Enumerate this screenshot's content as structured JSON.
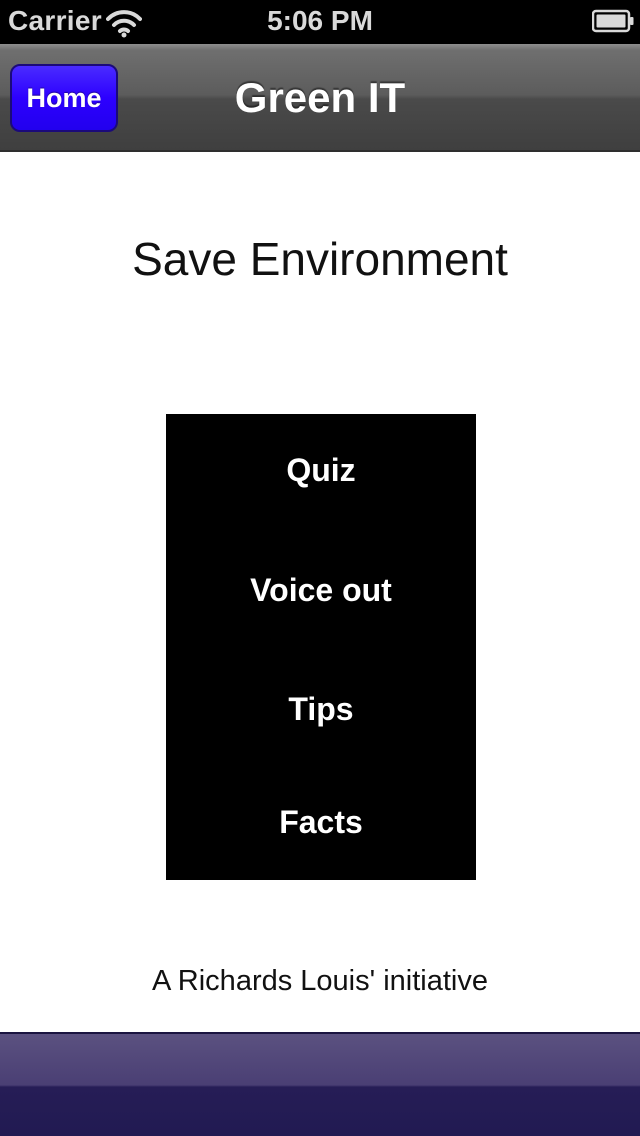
{
  "status_bar": {
    "carrier": "Carrier",
    "time": "5:06 PM",
    "wifi_icon": "wifi-icon",
    "battery_icon": "battery-icon"
  },
  "nav_bar": {
    "home_label": "Home",
    "title": "Green IT",
    "home_button_color": "#2d00ff"
  },
  "main": {
    "heading": "Save Environment",
    "menu": {
      "quiz": "Quiz",
      "voice_out": "Voice out",
      "tips": "Tips",
      "facts": "Facts"
    },
    "credit": "A Richards Louis' initiative"
  },
  "colors": {
    "menu_background": "#000000",
    "toolbar": "#261d56"
  }
}
